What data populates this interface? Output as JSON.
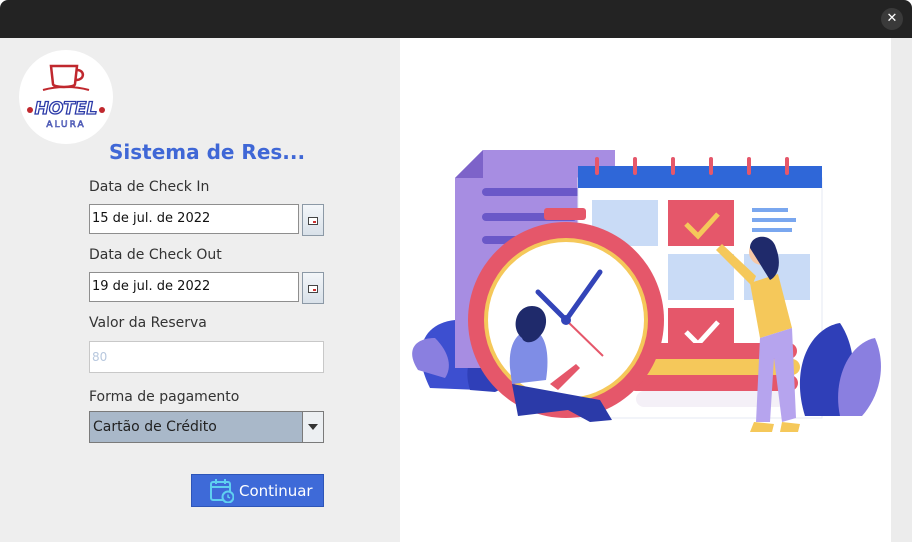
{
  "window": {
    "close_glyph": "✕"
  },
  "logo": {
    "line1": "HOTEL",
    "line2": "ALURA"
  },
  "form": {
    "heading": "Sistema de Res...",
    "checkin_label": "Data de Check In",
    "checkin_value": "15 de jul. de 2022",
    "checkout_label": "Data de Check Out",
    "checkout_value": "19 de jul. de 2022",
    "valor_label": "Valor da Reserva",
    "valor_value": "80",
    "pagamento_label": "Forma de pagamento",
    "pagamento_value": "Cartão de Crédito",
    "continue_label": "Continuar"
  },
  "colors": {
    "accent": "#3e6ad8",
    "heading": "#3f67d6",
    "titlebar": "#232323",
    "panel": "#eeeeee"
  },
  "icons": [
    "close-icon",
    "calendar-icon",
    "chevron-down-icon",
    "calendar-clock-icon"
  ]
}
